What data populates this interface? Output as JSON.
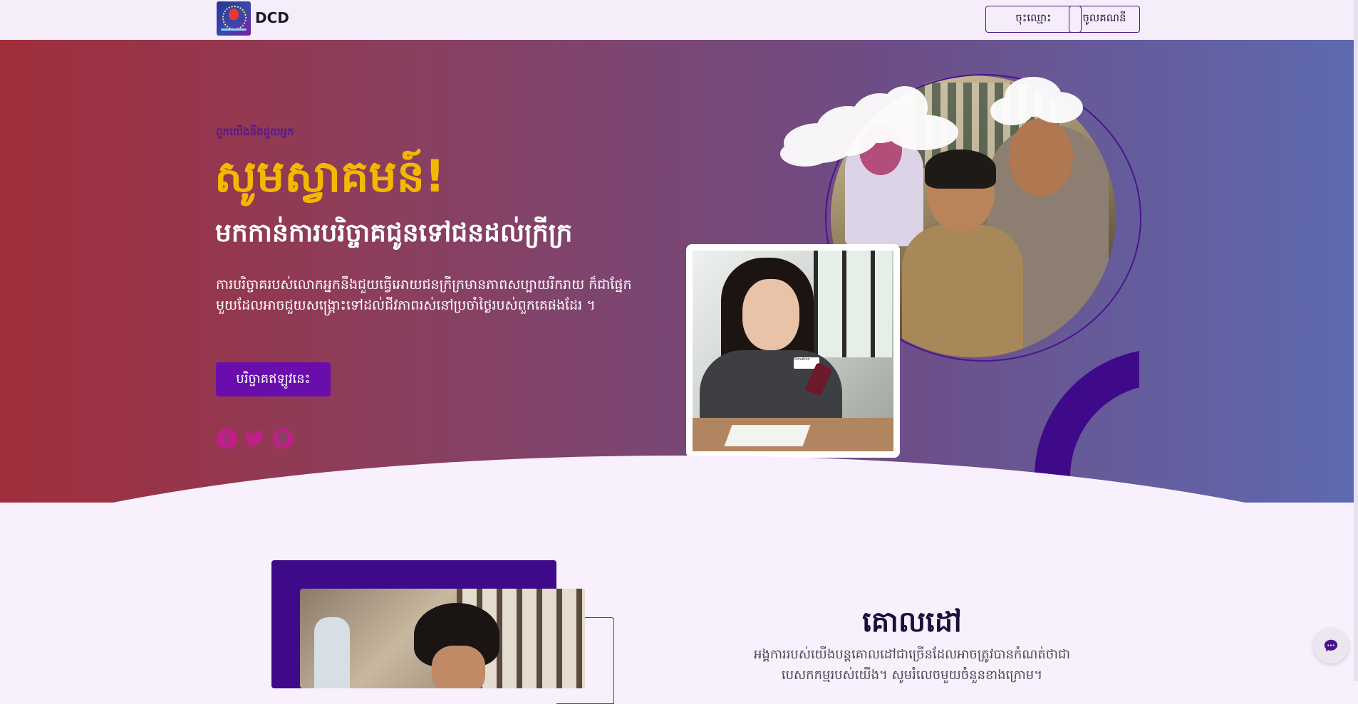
{
  "nav": {
    "brand": "DCD",
    "logo_icon": "dcd-logo",
    "register_label": "ចុះឈ្មោះ",
    "login_label": "ចូលគណនី"
  },
  "hero": {
    "eyebrow": "ពួកយើងនឹងជួយអ្នក",
    "headline": "សូមស្វាគមន៍!",
    "subhead": "មកកាន់ការបរិច្ចាគជូនទៅជនដល់ក្រីក្រ",
    "description": "ការបរិច្ចាគរបស់លោកអ្នកនឹងជួយធ្វើអោយជនក្រីក្រមានភាពសប្បាយរីករាយ ក៏ជាផ្នែកមួយដែលអាចជួយសង្គ្រោះទៅដល់ជីវភាពរស់នៅប្រចាំថ្ងៃរបស់ពួកគេផងដែរ ។",
    "cta_label": "បរិច្ចាគឥឡូវនេះ",
    "social": [
      {
        "icon": "facebook-icon"
      },
      {
        "icon": "twitter-icon"
      },
      {
        "icon": "github-icon"
      }
    ],
    "photo_badge": "Donation"
  },
  "goals": {
    "title": "គោលដៅ",
    "text": "អង្គការរបស់យើងបន្តគោលដៅជាច្រើនដែលអាចត្រូវបានកំណត់ថាជាបេសកកម្មរបស់យើង។ សូមរំលេចមួយចំនួនខាងក្រោម។"
  },
  "chat": {
    "icon": "chat-bubble-icon"
  },
  "colors": {
    "accent": "#6a0dad",
    "headline": "#f5b800",
    "hero_start": "#a12e3b",
    "hero_end": "#5d6ab0",
    "deco": "#3f0a8a"
  }
}
